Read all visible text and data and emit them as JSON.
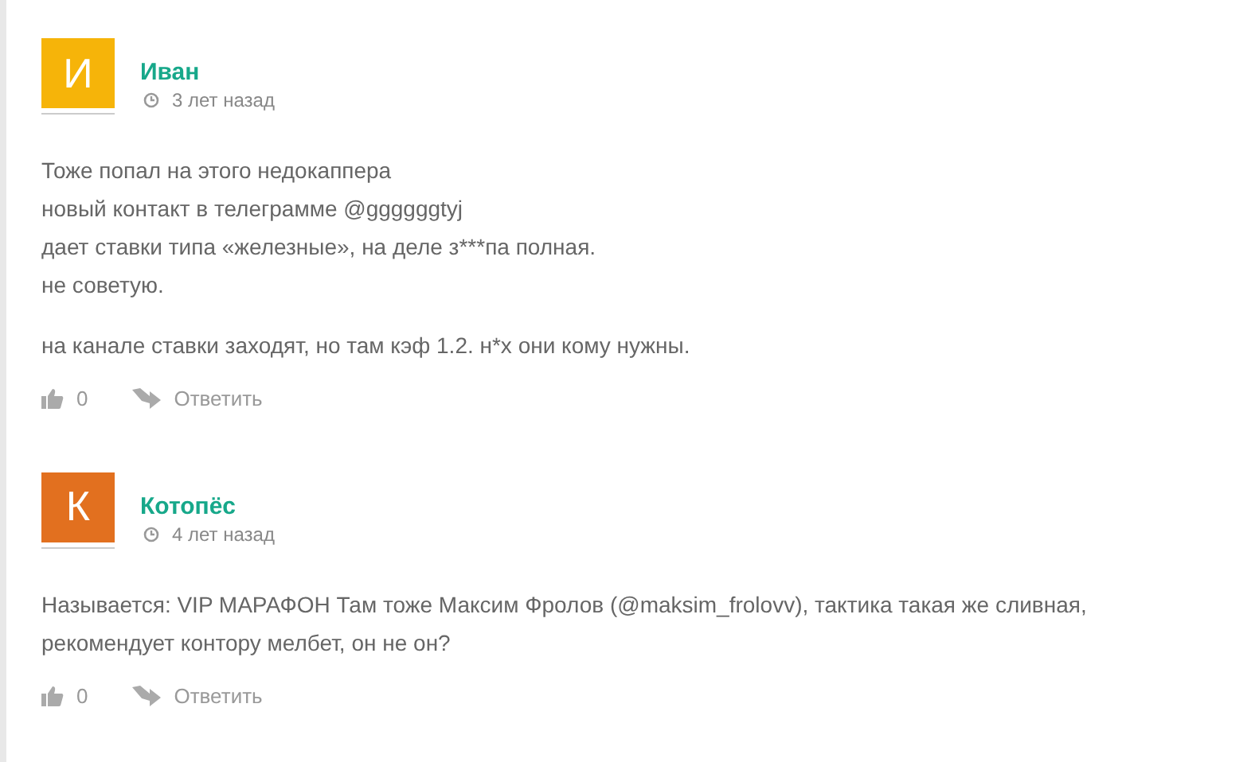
{
  "comments": [
    {
      "avatar_letter": "И",
      "color": "#f6b409",
      "author": "Иван",
      "time": "3 лет назад",
      "paragraphs": [
        [
          "Тоже попал на этого недокаппера",
          "новый контакт в телеграмме @ggggggtyj",
          "дает ставки типа «железные», на деле з***па полная.",
          "не советую."
        ],
        [
          "на канале ставки заходят, но там кэф 1.2. н*х они кому нужны."
        ]
      ],
      "likes": "0",
      "reply": "Ответить"
    },
    {
      "avatar_letter": "К",
      "color": "#e2701f",
      "author": "Котопёс",
      "time": "4 лет назад",
      "paragraphs": [
        [
          "Называется: VIP МАРАФОН Там тоже Максим Фролов (@maksim_frolovv), тактика такая же сливная, рекомендует контору мелбет, он не он?"
        ]
      ],
      "likes": "0",
      "reply": "Ответить"
    }
  ]
}
